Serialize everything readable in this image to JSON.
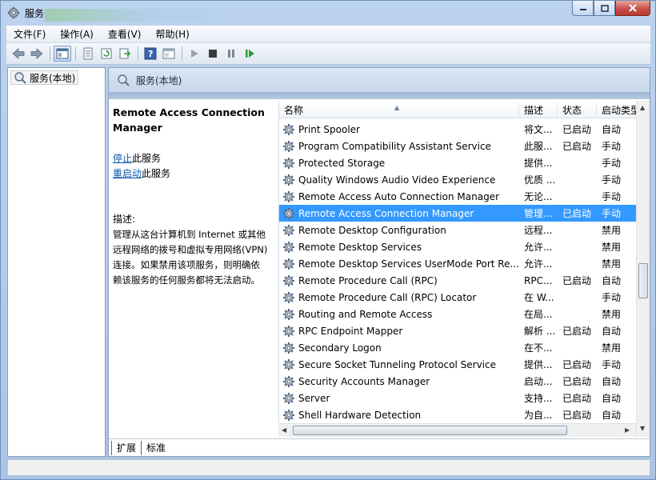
{
  "window": {
    "title": "服务"
  },
  "menu": [
    "文件(F)",
    "操作(A)",
    "查看(V)",
    "帮助(H)"
  ],
  "tree": {
    "root_label": "服务(本地)"
  },
  "pane": {
    "header_title": "服务(本地)",
    "selected_service": "Remote Access Connection Manager",
    "stop_link": "停止",
    "stop_suffix": "此服务",
    "restart_link": "重启动",
    "restart_suffix": "此服务",
    "desc_label": "描述:",
    "desc_lines": [
      "管理从这台计算机到 Internet 或其他",
      "远程网络的拨号和虚拟专用网络(VPN)",
      "连接。如果禁用该项服务，则明确依",
      "赖该服务的任何服务都将无法启动。"
    ]
  },
  "columns": {
    "name": "名称",
    "desc": "描述",
    "status": "状态",
    "startup": "启动类型"
  },
  "services": [
    {
      "name": "Print Spooler",
      "desc": "将文...",
      "status": "已启动",
      "startup": "自动"
    },
    {
      "name": "Program Compatibility Assistant Service",
      "desc": "此服...",
      "status": "已启动",
      "startup": "手动"
    },
    {
      "name": "Protected Storage",
      "desc": "提供...",
      "status": "",
      "startup": "手动"
    },
    {
      "name": "Quality Windows Audio Video Experience",
      "desc": "优质 ...",
      "status": "",
      "startup": "手动"
    },
    {
      "name": "Remote Access Auto Connection Manager",
      "desc": "无论...",
      "status": "",
      "startup": "手动"
    },
    {
      "name": "Remote Access Connection Manager",
      "desc": "管理...",
      "status": "已启动",
      "startup": "手动",
      "selected": true
    },
    {
      "name": "Remote Desktop Configuration",
      "desc": "远程...",
      "status": "",
      "startup": "禁用"
    },
    {
      "name": "Remote Desktop Services",
      "desc": "允许...",
      "status": "",
      "startup": "禁用"
    },
    {
      "name": "Remote Desktop Services UserMode Port Re...",
      "desc": "允许...",
      "status": "",
      "startup": "禁用"
    },
    {
      "name": "Remote Procedure Call (RPC)",
      "desc": "RPC...",
      "status": "已启动",
      "startup": "自动"
    },
    {
      "name": "Remote Procedure Call (RPC) Locator",
      "desc": "在 W...",
      "status": "",
      "startup": "手动"
    },
    {
      "name": "Routing and Remote Access",
      "desc": "在局...",
      "status": "",
      "startup": "禁用"
    },
    {
      "name": "RPC Endpoint Mapper",
      "desc": "解析 ...",
      "status": "已启动",
      "startup": "自动"
    },
    {
      "name": "Secondary Logon",
      "desc": "在不...",
      "status": "",
      "startup": "禁用"
    },
    {
      "name": "Secure Socket Tunneling Protocol Service",
      "desc": "提供...",
      "status": "已启动",
      "startup": "手动"
    },
    {
      "name": "Security Accounts Manager",
      "desc": "启动...",
      "status": "已启动",
      "startup": "自动"
    },
    {
      "name": "Server",
      "desc": "支持...",
      "status": "已启动",
      "startup": "自动"
    },
    {
      "name": "Shell Hardware Detection",
      "desc": "为自...",
      "status": "已启动",
      "startup": "自动"
    }
  ],
  "tabs": [
    "扩展",
    "标准"
  ],
  "colors": {
    "selection": "#3399ff",
    "link": "#0a56b0",
    "accent": "#6d8fb8"
  },
  "icons": [
    "gear-icon",
    "back-arrow-icon",
    "forward-arrow-icon",
    "play-icon",
    "stop-icon",
    "pause-icon",
    "restart-icon"
  ]
}
